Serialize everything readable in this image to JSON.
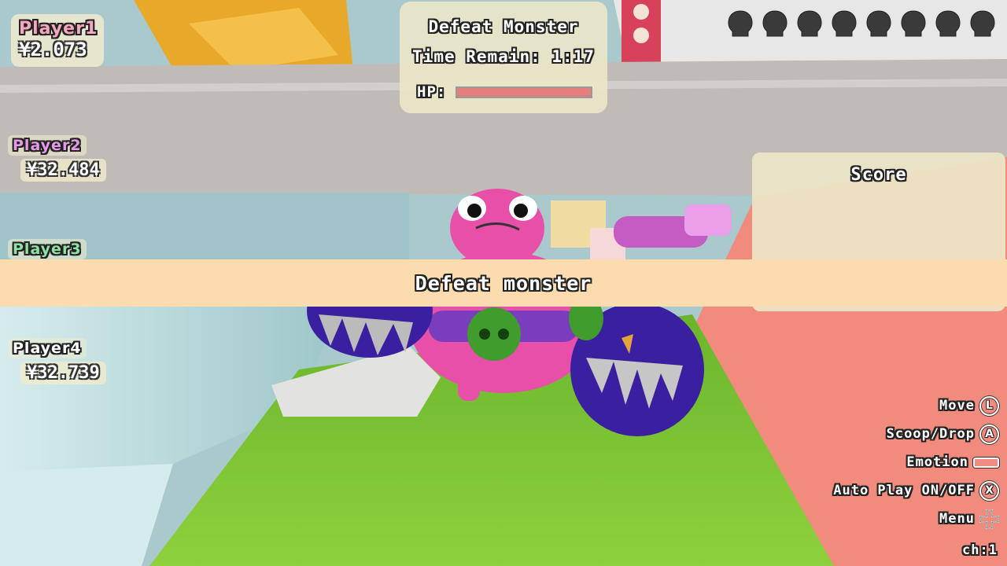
{
  "players": [
    {
      "name": "Player1",
      "money": "¥2.073",
      "name_color": "#f6a7c0"
    },
    {
      "name": "Player2",
      "money": "¥32.484",
      "name_color": "#e49ae8"
    },
    {
      "name": "Player3",
      "money": "",
      "name_color": "#8ee2a4"
    },
    {
      "name": "Player4",
      "money": "¥32.739",
      "name_color": "#ffffff"
    }
  ],
  "objective": {
    "title": "Defeat Monster",
    "time_remain": "Time Remain: 1:17",
    "hp_label": "HP:",
    "hp_fraction": 1.0
  },
  "skull_count": 8,
  "score": {
    "title": "Score"
  },
  "banner": {
    "text": "Defeat monster"
  },
  "controls": [
    {
      "label": "Move",
      "icon": "L",
      "icon_type": "stick-l-icon"
    },
    {
      "label": "Scoop/Drop",
      "icon": "A",
      "icon_type": "button-a-icon"
    },
    {
      "label": "Emotion",
      "icon": "",
      "icon_type": "trigger-icon"
    },
    {
      "label": "Auto Play ON/OFF",
      "icon": "X",
      "icon_type": "button-x-icon"
    },
    {
      "label": "Menu",
      "icon": "",
      "icon_type": "dpad-icon"
    }
  ],
  "channel": "ch:1",
  "colors": {
    "banner": "#fcdcae",
    "panel": "#ebe6c8",
    "hp_fill": "#e47f7f"
  }
}
